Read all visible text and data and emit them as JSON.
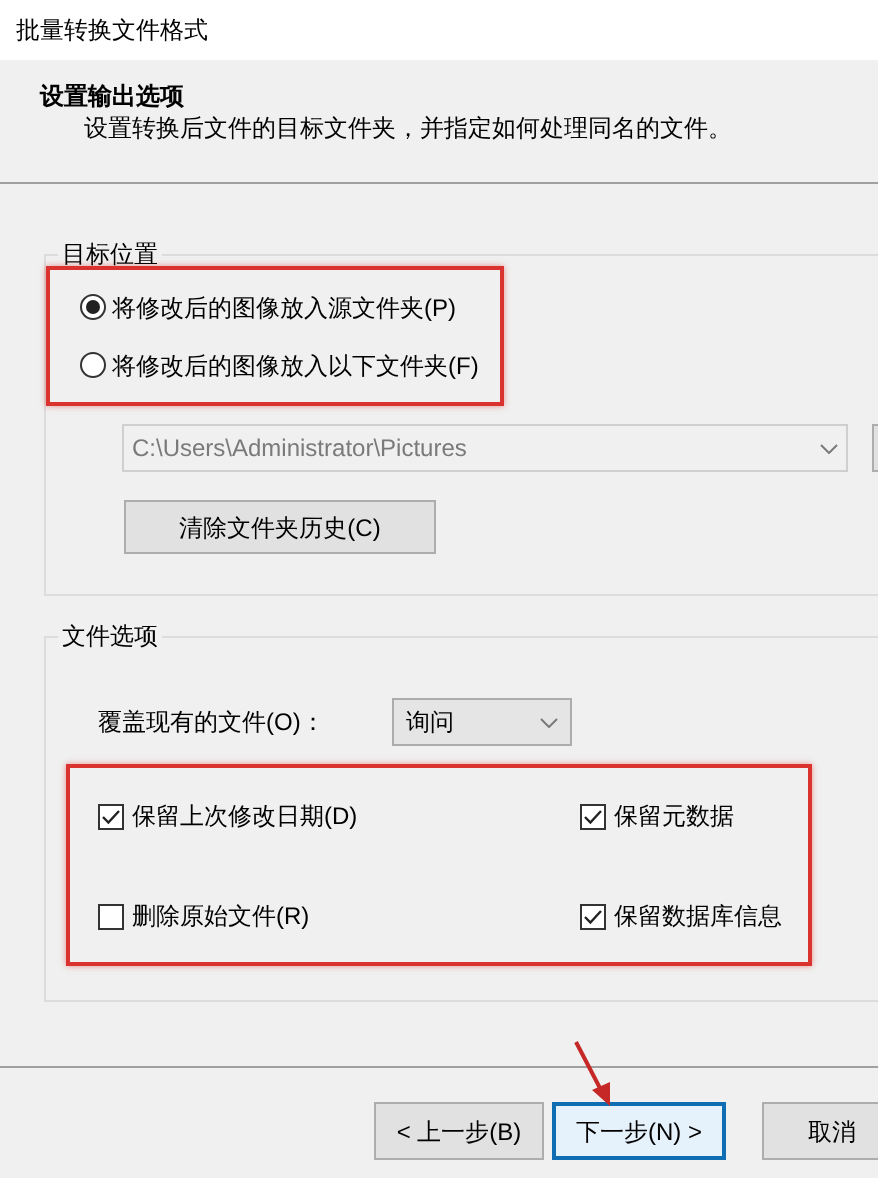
{
  "window": {
    "title": "批量转换文件格式"
  },
  "header": {
    "title": "设置输出选项",
    "description": "设置转换后文件的目标文件夹，并指定如何处理同名的文件。"
  },
  "target_group": {
    "legend": "目标位置",
    "highlighted": true,
    "options": [
      {
        "label": "将修改后的图像放入源文件夹(P)",
        "selected": true
      },
      {
        "label": "将修改后的图像放入以下文件夹(F)",
        "selected": false
      }
    ],
    "folder_field": {
      "value": "C:\\Users\\Administrator\\Pictures",
      "disabled": true
    },
    "clear_button": {
      "label": "清除文件夹历史(C)"
    }
  },
  "file_group": {
    "legend": "文件选项",
    "overwrite": {
      "label": "覆盖现有的文件(O)：",
      "value": "询问"
    },
    "highlighted": true,
    "checkboxes": [
      {
        "label": "保留上次修改日期(D)",
        "checked": true
      },
      {
        "label": "保留元数据",
        "checked": true
      },
      {
        "label": "删除原始文件(R)",
        "checked": false
      },
      {
        "label": "保留数据库信息",
        "checked": true
      }
    ]
  },
  "buttons": [
    {
      "label": "< 上一步(B)",
      "focused": false,
      "pointed": false
    },
    {
      "label": "下一步(N) >",
      "focused": true,
      "pointed": true
    },
    {
      "label": "取消",
      "focused": false,
      "pointed": false
    }
  ]
}
